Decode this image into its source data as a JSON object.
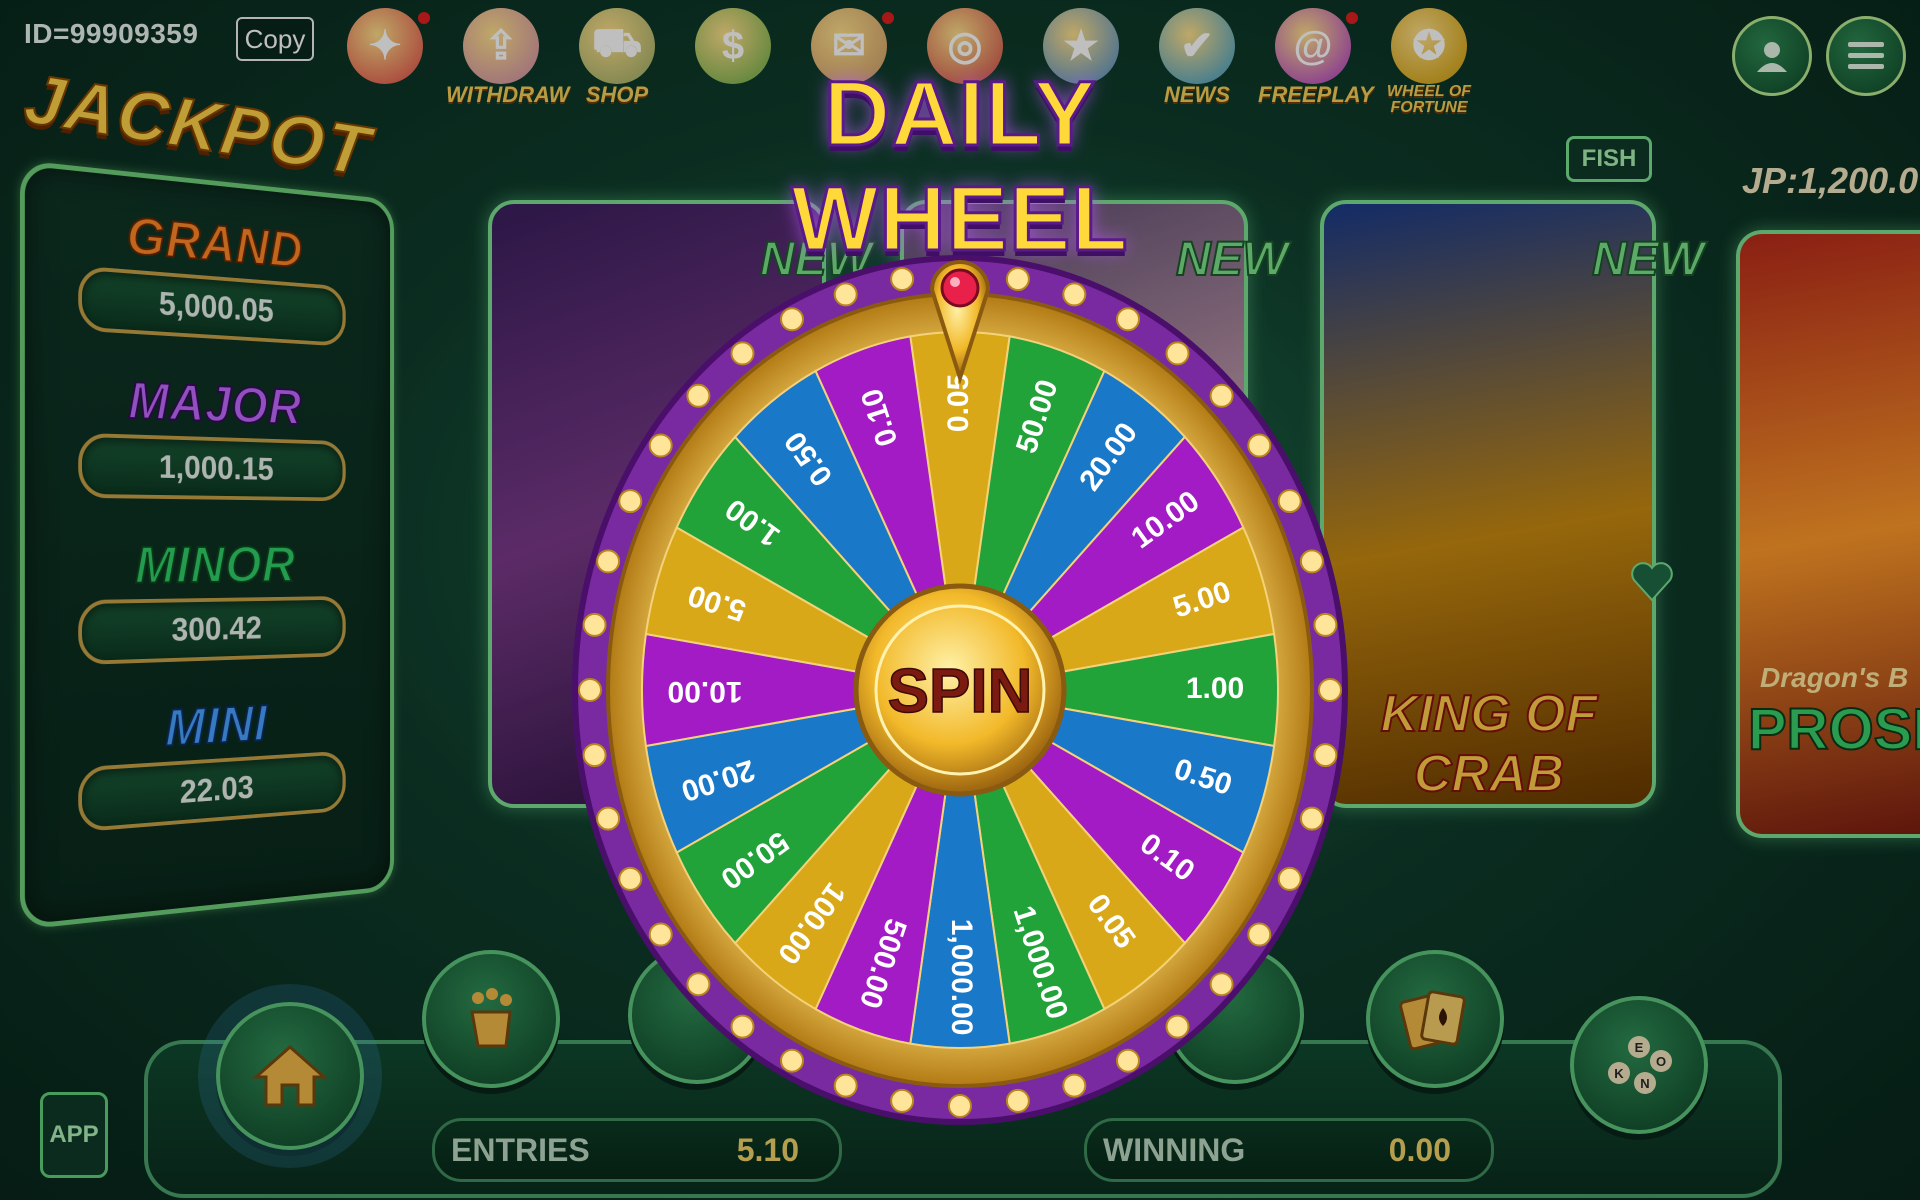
{
  "header": {
    "user_id": "ID=99909359",
    "copy_label": "Copy",
    "icons": [
      {
        "name": "prize-wheel",
        "label": "",
        "dot": true
      },
      {
        "name": "withdraw",
        "label": "WITHDRAW",
        "dot": false
      },
      {
        "name": "shop",
        "label": "SHOP",
        "dot": false
      },
      {
        "name": "cashback",
        "label": "",
        "dot": false
      },
      {
        "name": "mail",
        "label": "",
        "dot": true
      },
      {
        "name": "spin",
        "label": "",
        "dot": false
      },
      {
        "name": "vip-star",
        "label": "",
        "dot": false
      },
      {
        "name": "news",
        "label": "NEWS",
        "dot": false
      },
      {
        "name": "freeplay",
        "label": "FREEPLAY",
        "dot": true
      },
      {
        "name": "wheel-of-fortune",
        "label": "WHEEL OF FORTUNE",
        "dot": false
      }
    ]
  },
  "jackpot": {
    "title": "JACKPOT",
    "tiers": [
      {
        "name": "GRAND",
        "value": "5,000.05",
        "color": "#ff8a2a"
      },
      {
        "name": "MAJOR",
        "value": "1,000.15",
        "color": "#c06cff"
      },
      {
        "name": "MINOR",
        "value": "300.42",
        "color": "#2fd06a"
      },
      {
        "name": "MINI",
        "value": "22.03",
        "color": "#4aa3ff"
      }
    ]
  },
  "cards": {
    "new_label": "NEW",
    "fish_label": "FISH",
    "king_of_crab": "KING OF CRAB",
    "dragon_sub": "Dragon's B",
    "dragon_title": "PROSP",
    "jp_text": "JP:1,200.0"
  },
  "wheel": {
    "title": "DAILY WHEEL",
    "spin_label": "SPIN",
    "colors": {
      "purple": "#a21bc4",
      "yellow": "#d9a818",
      "green": "#21a33a",
      "blue": "#1a78c8",
      "rim": "#8b2fb0",
      "gold": "#f5c542"
    },
    "segments": [
      {
        "label": "0.05",
        "color": "yellow"
      },
      {
        "label": "50.00",
        "color": "green"
      },
      {
        "label": "20.00",
        "color": "blue"
      },
      {
        "label": "10.00",
        "color": "purple"
      },
      {
        "label": "5.00",
        "color": "yellow"
      },
      {
        "label": "1.00",
        "color": "green"
      },
      {
        "label": "0.50",
        "color": "blue"
      },
      {
        "label": "0.10",
        "color": "purple"
      },
      {
        "label": "0.05",
        "color": "yellow"
      },
      {
        "label": "1,000.00",
        "color": "green"
      },
      {
        "label": "1,000.00",
        "color": "blue"
      },
      {
        "label": "500.00",
        "color": "purple"
      },
      {
        "label": "100.00",
        "color": "yellow"
      },
      {
        "label": "50.00",
        "color": "green"
      },
      {
        "label": "20.00",
        "color": "blue"
      },
      {
        "label": "10.00",
        "color": "purple"
      },
      {
        "label": "5.00",
        "color": "yellow"
      },
      {
        "label": "1.00",
        "color": "green"
      },
      {
        "label": "0.50",
        "color": "blue"
      },
      {
        "label": "0.10",
        "color": "purple"
      }
    ]
  },
  "bottom": {
    "app_label": "APP",
    "entries_label": "ENTRIES",
    "entries_value": "5.10",
    "winning_label": "WINNING",
    "winning_value": "0.00",
    "keno_letters": [
      "E",
      "O",
      "K",
      "N"
    ]
  }
}
